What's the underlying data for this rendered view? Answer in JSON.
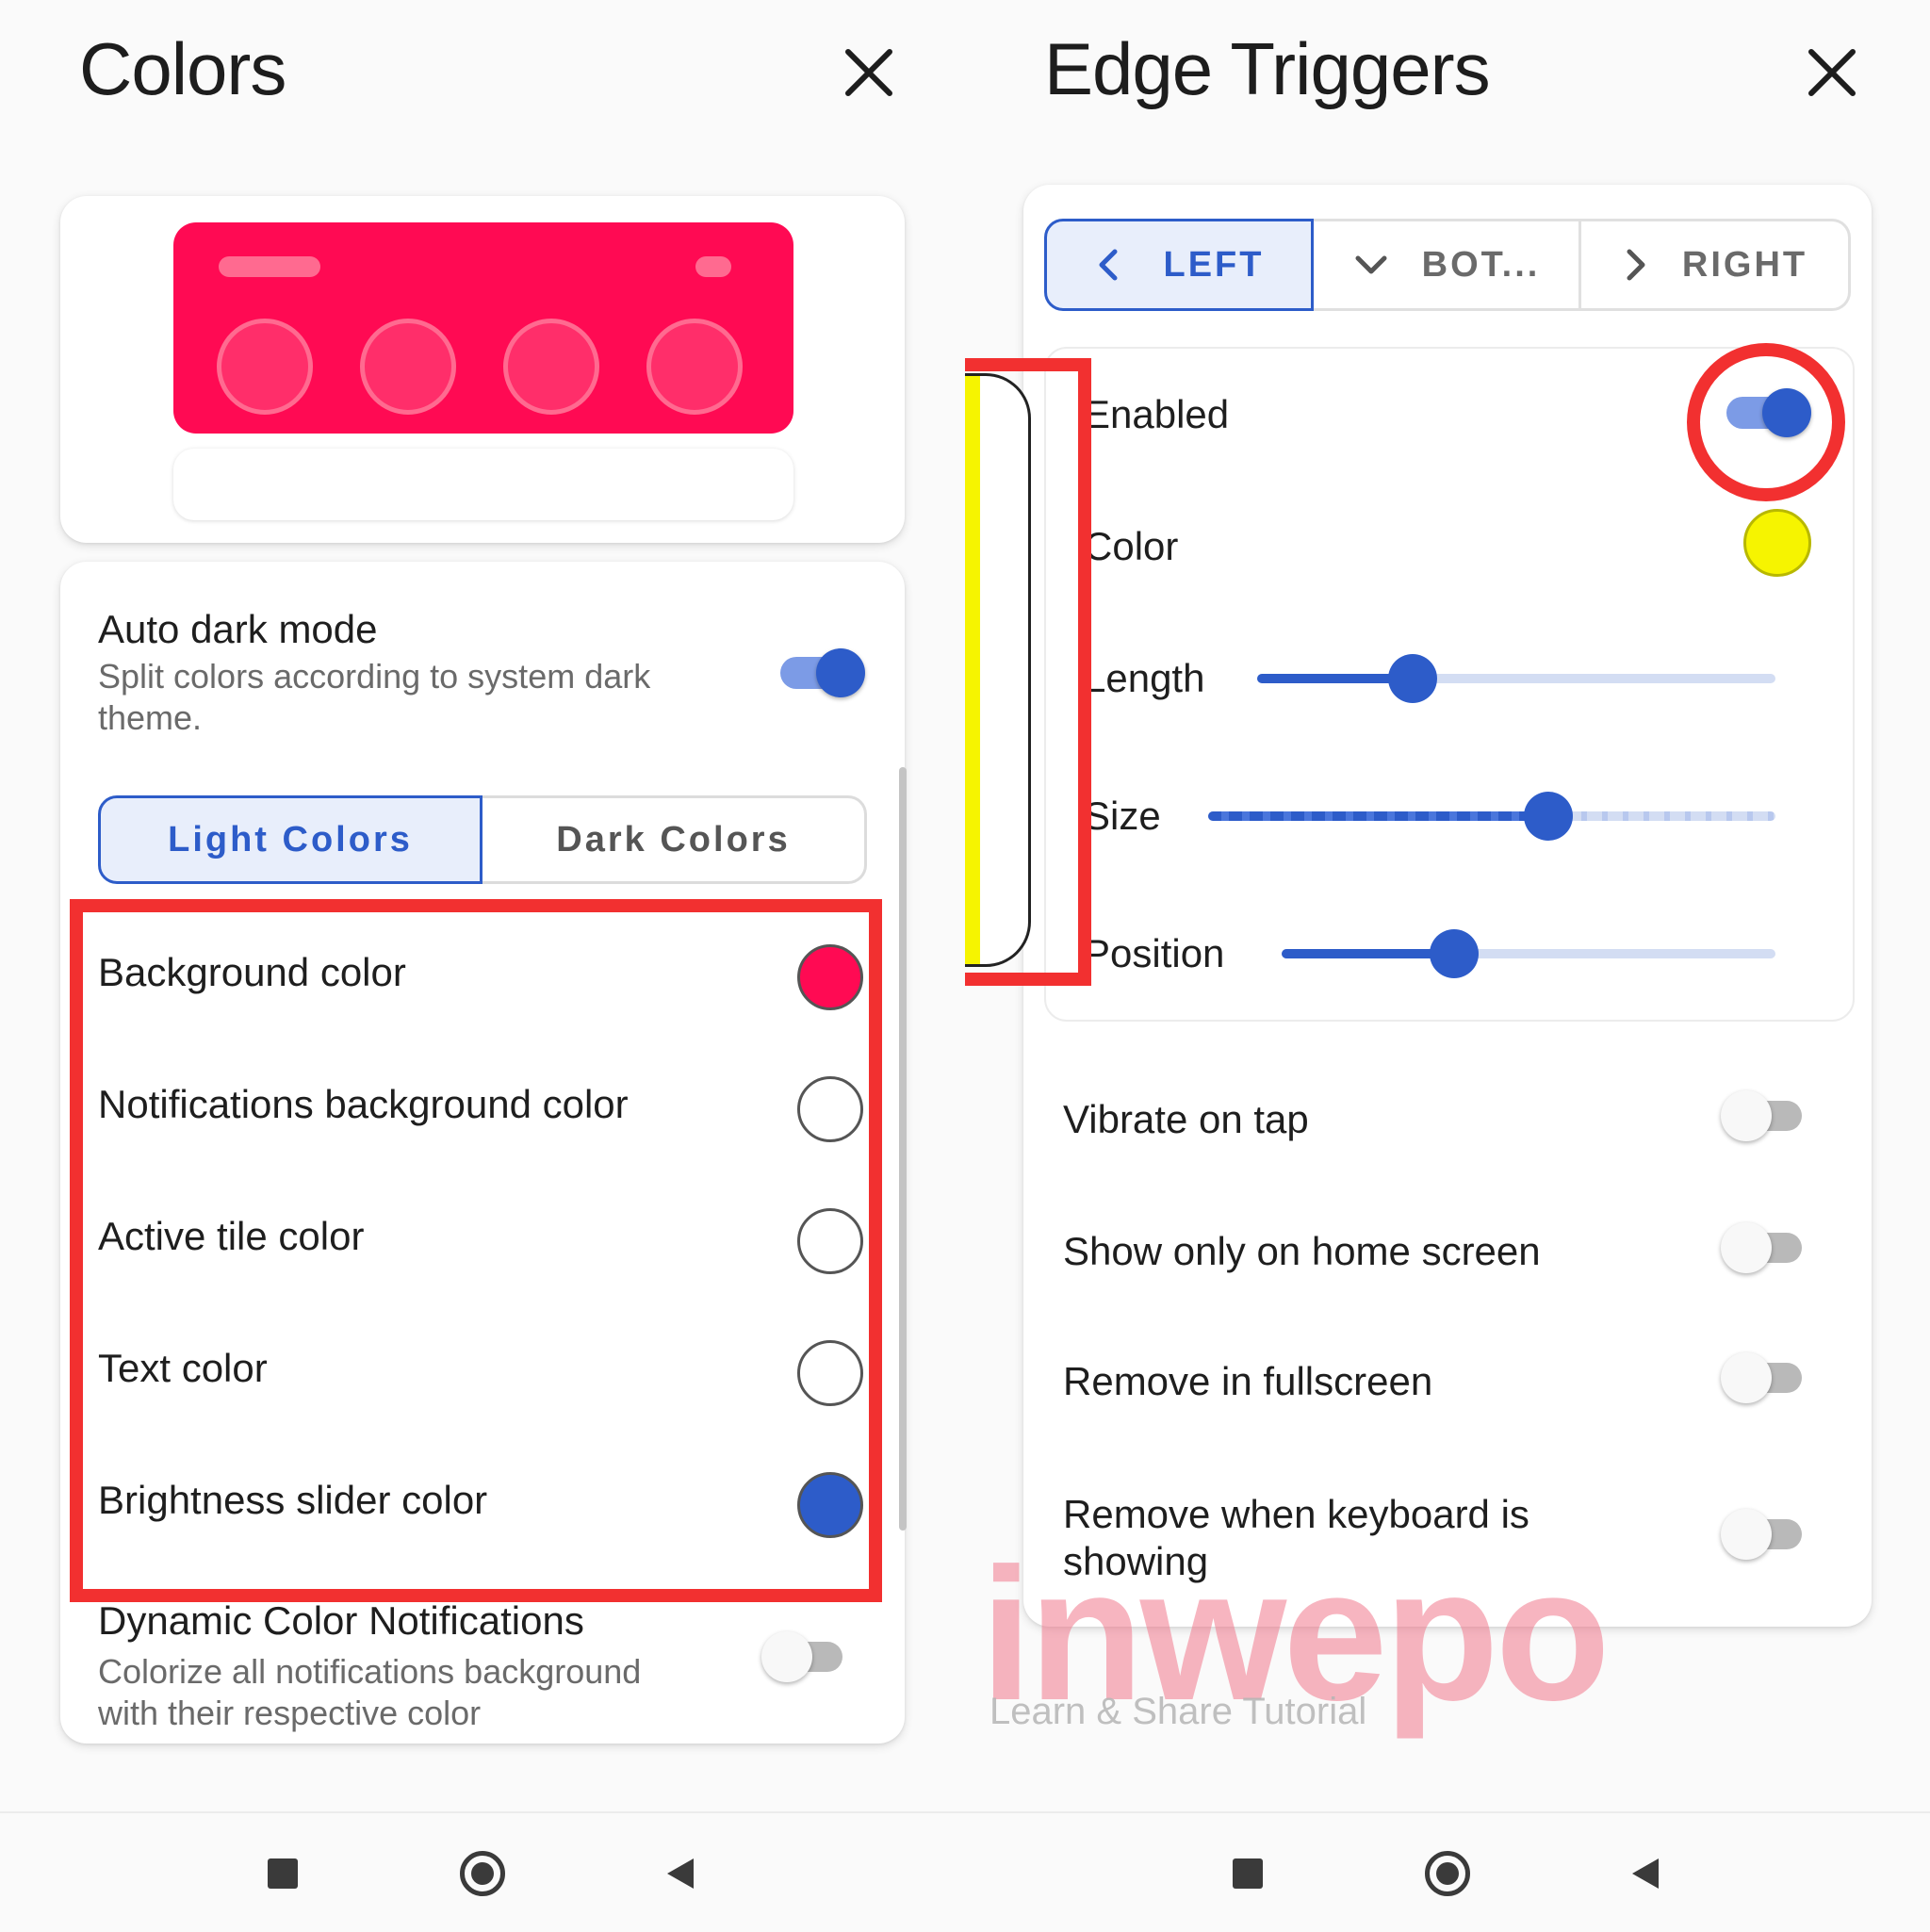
{
  "left_panel": {
    "title": "Colors",
    "close_icon": "close-icon",
    "preview": {
      "accent_color": "#ff0a53"
    },
    "auto_dark_mode": {
      "label": "Auto dark mode",
      "description": "Split colors according to system dark theme.",
      "enabled": true
    },
    "tabs": [
      {
        "label": "Light Colors",
        "selected": true
      },
      {
        "label": "Dark Colors",
        "selected": false
      }
    ],
    "color_rows": [
      {
        "label": "Background color",
        "color": "#ff0a53"
      },
      {
        "label": "Notifications background color",
        "color": "#ffffff"
      },
      {
        "label": "Active tile color",
        "color": "#ffffff"
      },
      {
        "label": "Text color",
        "color": "#ffffff"
      },
      {
        "label": "Brightness slider color",
        "color": "#2d5cc9"
      }
    ],
    "dynamic_notifications": {
      "label": "Dynamic Color Notifications",
      "description": "Colorize all notifications background with their respective color",
      "enabled": false
    }
  },
  "right_panel": {
    "title": "Edge Triggers",
    "close_icon": "close-icon",
    "edge_tabs": [
      {
        "label": "LEFT",
        "icon": "chevron-left-icon",
        "selected": true
      },
      {
        "label": "BOT...",
        "icon": "chevron-down-icon",
        "selected": false
      },
      {
        "label": "RIGHT",
        "icon": "chevron-right-icon",
        "selected": false
      }
    ],
    "enabled": {
      "label": "Enabled",
      "value": true
    },
    "color": {
      "label": "Color",
      "value": "#f6f400"
    },
    "length": {
      "label": "Length",
      "value": 0.3
    },
    "size": {
      "label": "Size",
      "value": 0.6
    },
    "position": {
      "label": "Position",
      "value": 0.35
    },
    "toggles": [
      {
        "label": "Vibrate on tap",
        "value": false
      },
      {
        "label": "Show only on home screen",
        "value": false
      },
      {
        "label": "Remove in fullscreen",
        "value": false
      },
      {
        "label": "Remove when keyboard is showing",
        "value": false
      }
    ]
  },
  "watermark": {
    "brand": "inwepo",
    "tagline": "Learn & Share Tutorial"
  },
  "nav_icons": [
    "recents-square-icon",
    "home-circle-icon",
    "back-triangle-icon"
  ],
  "colors": {
    "accent_blue": "#2d5cc9",
    "highlight_red": "#f23030",
    "edge_yellow": "#f6f400"
  }
}
